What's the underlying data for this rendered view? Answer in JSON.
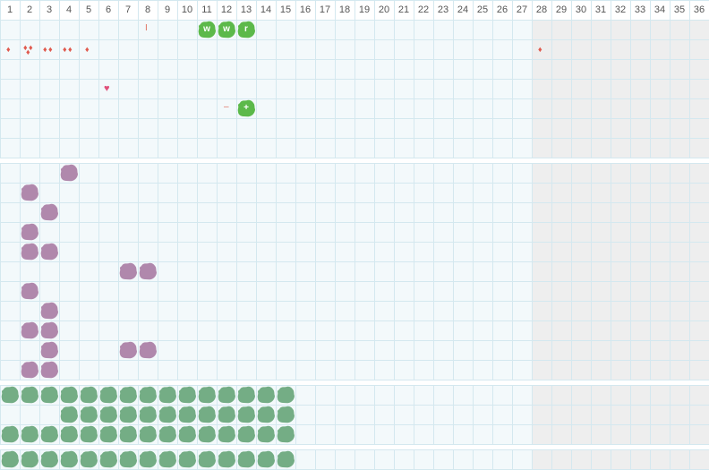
{
  "days": [
    "1",
    "2",
    "3",
    "4",
    "5",
    "6",
    "7",
    "8",
    "9",
    "10",
    "11",
    "12",
    "13",
    "14",
    "15",
    "16",
    "17",
    "18",
    "19",
    "20",
    "21",
    "22",
    "23",
    "24",
    "25",
    "26",
    "27",
    "28",
    "29",
    "30",
    "31",
    "32",
    "33",
    "34",
    "35",
    "36"
  ],
  "colors": {
    "grid_line": "#d4e8ef",
    "cell_bg": "#f3f9fb",
    "shaded_bg": "#eeeeee",
    "separator": "#ffffff",
    "green_tag": "#5cb94a",
    "purple_blob": "#b088ac",
    "teal_blob": "#74ad85",
    "drop": "#e05a4e",
    "heart": "#e0507a"
  },
  "shaded_from_day": 28,
  "sections": [
    {
      "name": "tracking",
      "rows": 7
    },
    {
      "name": "purple",
      "rows": 11
    },
    {
      "name": "teal-a",
      "rows": 3
    },
    {
      "name": "teal-b",
      "rows": 1
    }
  ],
  "markers": {
    "green_tags": [
      {
        "day": 11,
        "row": 0,
        "label": "w"
      },
      {
        "day": 12,
        "row": 0,
        "label": "w"
      },
      {
        "day": 13,
        "row": 0,
        "label": "r"
      },
      {
        "day": 13,
        "row": 4,
        "label": "+"
      }
    ],
    "drops": [
      {
        "day": 1,
        "row": 1,
        "count": 1
      },
      {
        "day": 2,
        "row": 1,
        "count": 3
      },
      {
        "day": 3,
        "row": 1,
        "count": 2
      },
      {
        "day": 4,
        "row": 1,
        "count": 2
      },
      {
        "day": 5,
        "row": 1,
        "count": 1
      },
      {
        "day": 28,
        "row": 1,
        "count": 1
      }
    ],
    "hearts": [
      {
        "day": 6,
        "row": 3
      }
    ],
    "ticks": [
      {
        "day": 8,
        "row": 0,
        "text": "I"
      },
      {
        "day": 12,
        "row": 4,
        "text": "–"
      }
    ]
  },
  "purple_blobs": [
    [
      4
    ],
    [
      2
    ],
    [
      3
    ],
    [
      2
    ],
    [
      2,
      3
    ],
    [
      7,
      8
    ],
    [
      2
    ],
    [
      3
    ],
    [
      2,
      3
    ],
    [
      3,
      7,
      8
    ],
    [
      2,
      3
    ]
  ],
  "teal_rows": [
    {
      "section": 2,
      "row": 0,
      "from": 1,
      "to": 15
    },
    {
      "section": 2,
      "row": 1,
      "from": 4,
      "to": 15
    },
    {
      "section": 2,
      "row": 2,
      "from": 1,
      "to": 15
    },
    {
      "section": 3,
      "row": 0,
      "from": 1,
      "to": 15
    }
  ]
}
